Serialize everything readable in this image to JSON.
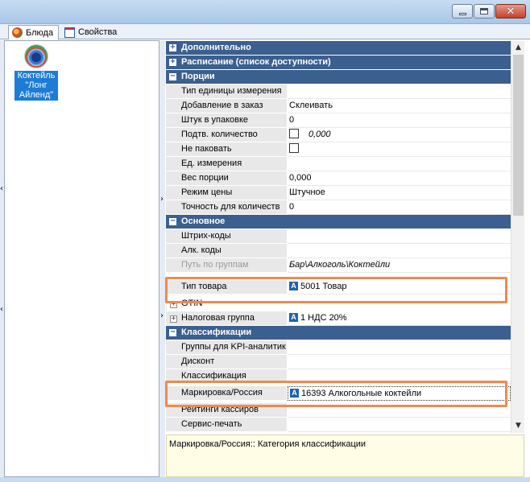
{
  "window": {
    "minimize_icon": "minimize-icon",
    "maximize_icon": "maximize-icon",
    "close_icon": "close-icon",
    "close_glyph": "✕"
  },
  "tabs": [
    {
      "label": "Блюда",
      "icon": "dish-icon",
      "active": true
    },
    {
      "label": "Свойства",
      "icon": "properties-icon",
      "active": false
    }
  ],
  "dish_list": {
    "items": [
      {
        "label": "Коктейль \"Лонг Айленд\"",
        "selected": true
      }
    ]
  },
  "property_grid": {
    "categories": [
      {
        "label": "Дополнительно",
        "expander": "+",
        "expanded": false
      },
      {
        "label": "Расписание (список доступности)",
        "expander": "+",
        "expanded": false
      },
      {
        "label": "Порции",
        "expander": "−",
        "expanded": true,
        "props": [
          {
            "name": "Тип единицы измерения",
            "value": ""
          },
          {
            "name": "Добавление в заказ",
            "value": "Склеивать"
          },
          {
            "name": "Штук в упаковке",
            "value": "0"
          },
          {
            "name": "Подтв. количество",
            "value": "",
            "checkbox": true,
            "extra": "0,000"
          },
          {
            "name": "Не паковать",
            "value": "",
            "checkbox": true
          },
          {
            "name": "Ед. измерения",
            "value": ""
          },
          {
            "name": "Вес порции",
            "value": "0,000"
          },
          {
            "name": "Режим цены",
            "value": "Штучное"
          },
          {
            "name": "Точность для количеств",
            "value": "0"
          }
        ]
      },
      {
        "label": "Основное",
        "expander": "−",
        "expanded": true,
        "props": [
          {
            "name": "Штрих-коды",
            "value": ""
          },
          {
            "name": "Алк. коды",
            "value": ""
          },
          {
            "name": "Путь по группам",
            "value": "Бар\\Алкоголь\\Коктейли",
            "gray": true
          },
          {
            "name": "Тип товара",
            "value": "5001 Товар",
            "icon": "A"
          },
          {
            "name": "GTIN",
            "value": "",
            "plus": true
          },
          {
            "name": "Налоговая группа",
            "value": "1 НДС 20%",
            "icon": "A",
            "plus": true
          }
        ]
      },
      {
        "label": "Классификации",
        "expander": "−",
        "expanded": true,
        "props": [
          {
            "name": "Группы для KPI-аналитик",
            "value": ""
          },
          {
            "name": "Дисконт",
            "value": ""
          },
          {
            "name": "Классификация",
            "value": ""
          },
          {
            "name": "Маркировка/Россия",
            "value": "16393 Алкогольные коктейли",
            "icon": "A"
          },
          {
            "name": "Рейтинги кассиров",
            "value": ""
          },
          {
            "name": "Сервис-печать",
            "value": ""
          }
        ]
      }
    ]
  },
  "scrollbar": {
    "up": "▲",
    "down": "▼"
  },
  "splitter": {
    "arrow": "›",
    "arrow_left": "‹"
  },
  "description": {
    "text": "Маркировка/Россия:: Категория классификации"
  },
  "colors": {
    "category_header": "#3b5f8e",
    "highlight": "#ee8a4e",
    "selection": "#1c7cd6"
  }
}
